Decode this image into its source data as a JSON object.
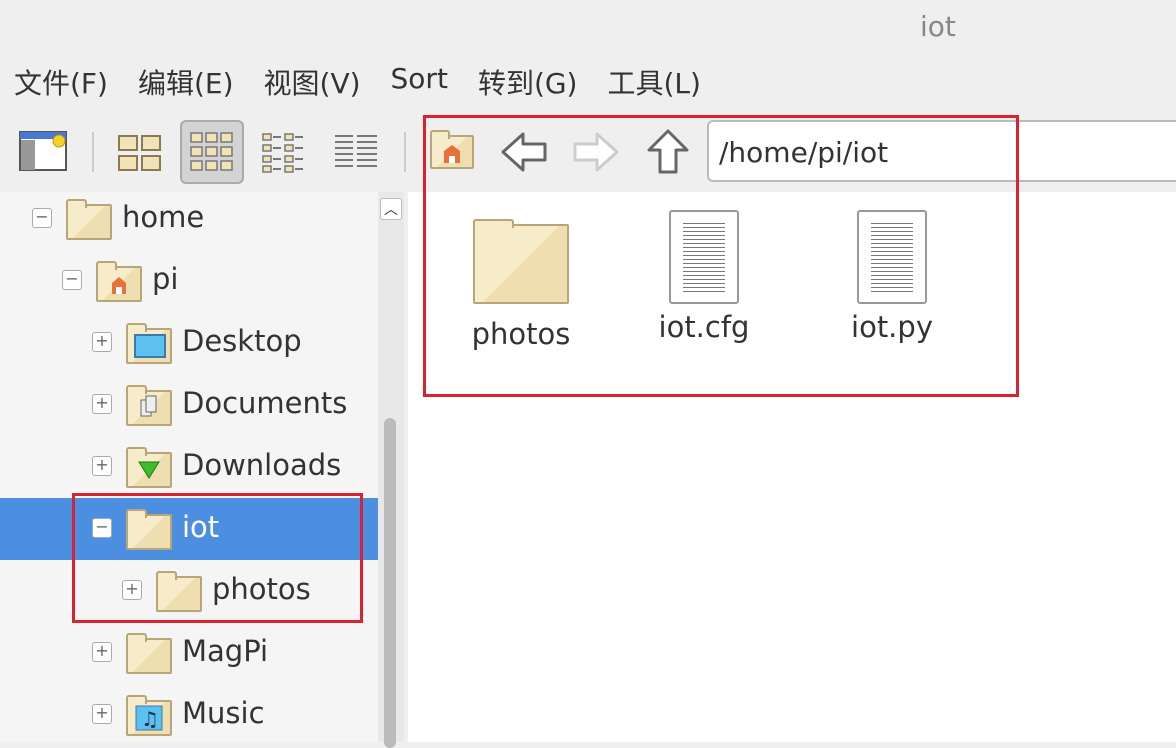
{
  "window": {
    "title": "iot"
  },
  "menu": [
    "文件(F)",
    "编辑(E)",
    "视图(V)",
    "Sort",
    "转到(G)",
    "工具(L)"
  ],
  "toolbar": {
    "path": "/home/pi/iot",
    "view_mode": "icon-view"
  },
  "tree": [
    {
      "label": "home",
      "toggle": "−",
      "icon": "folder-icon"
    },
    {
      "label": "pi",
      "toggle": "−",
      "icon": "home-folder-icon"
    },
    {
      "label": "Desktop",
      "toggle": "+",
      "icon": "desktop-folder-icon"
    },
    {
      "label": "Documents",
      "toggle": "+",
      "icon": "documents-folder-icon"
    },
    {
      "label": "Downloads",
      "toggle": "+",
      "icon": "downloads-folder-icon"
    },
    {
      "label": "iot",
      "toggle": "−",
      "icon": "folder-icon",
      "selected": true
    },
    {
      "label": "photos",
      "toggle": "+",
      "icon": "folder-icon"
    },
    {
      "label": "MagPi",
      "toggle": "+",
      "icon": "folder-icon"
    },
    {
      "label": "Music",
      "toggle": "+",
      "icon": "music-folder-icon"
    }
  ],
  "files": [
    {
      "name": "photos",
      "type": "folder"
    },
    {
      "name": "iot.cfg",
      "type": "text-file"
    },
    {
      "name": "iot.py",
      "type": "text-file"
    }
  ],
  "colors": {
    "selection": "#4c8fe0",
    "highlight_box": "#d9232e"
  }
}
